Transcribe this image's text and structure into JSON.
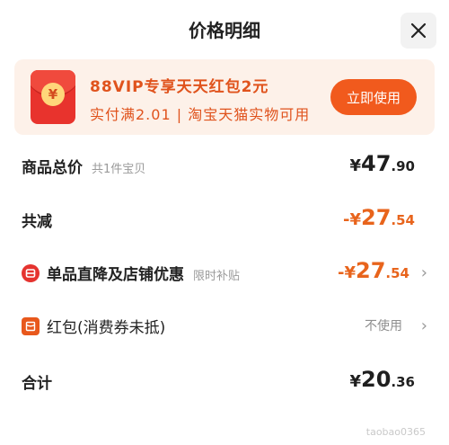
{
  "header": {
    "title": "价格明细"
  },
  "banner": {
    "line1": "88VIP专享天天红包2元",
    "line2": "实付满2.01 | 淘宝天猫实物可用",
    "button_label": "立即使用",
    "coin_symbol": "¥"
  },
  "rows": {
    "total_price": {
      "label": "商品总价",
      "sub": "共1件宝贝",
      "currency": "¥",
      "int": "47",
      "dec": ".90"
    },
    "total_discount": {
      "label": "共减",
      "currency": "-¥",
      "int": "27",
      "dec": ".54"
    },
    "shop_discount": {
      "label": "单品直降及店铺优惠",
      "sub": "限时补贴",
      "currency": "-¥",
      "int": "27",
      "dec": ".54"
    },
    "red_packet": {
      "label": "红包(消费券未抵)",
      "note": "不使用"
    },
    "sum": {
      "label": "合计",
      "currency": "¥",
      "int": "20",
      "dec": ".36"
    }
  },
  "watermark": "taobao0365",
  "colors": {
    "accent": "#f15a1d",
    "discount": "#e8641c",
    "banner_bg": "#fdf1e9"
  }
}
